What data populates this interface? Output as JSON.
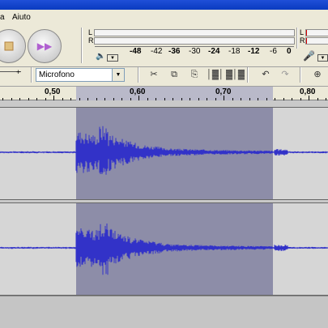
{
  "menu": {
    "item_a": "a",
    "item_help": "Aiuto"
  },
  "meters": {
    "left_label": "L",
    "right_label": "R",
    "left_label_b": "L",
    "right_label_b": "R",
    "scale": [
      "-48",
      "-42",
      "-36",
      "-30",
      "-24",
      "-18",
      "-12",
      "-6",
      "0"
    ]
  },
  "input": {
    "device": "Microfono"
  },
  "ruler": {
    "labels": [
      "0,50",
      "0,60",
      "0,70",
      "0,80"
    ]
  },
  "colors": {
    "waveform": "#3232c8",
    "selection": "#8d8da8",
    "background": "#d6d6d6"
  }
}
